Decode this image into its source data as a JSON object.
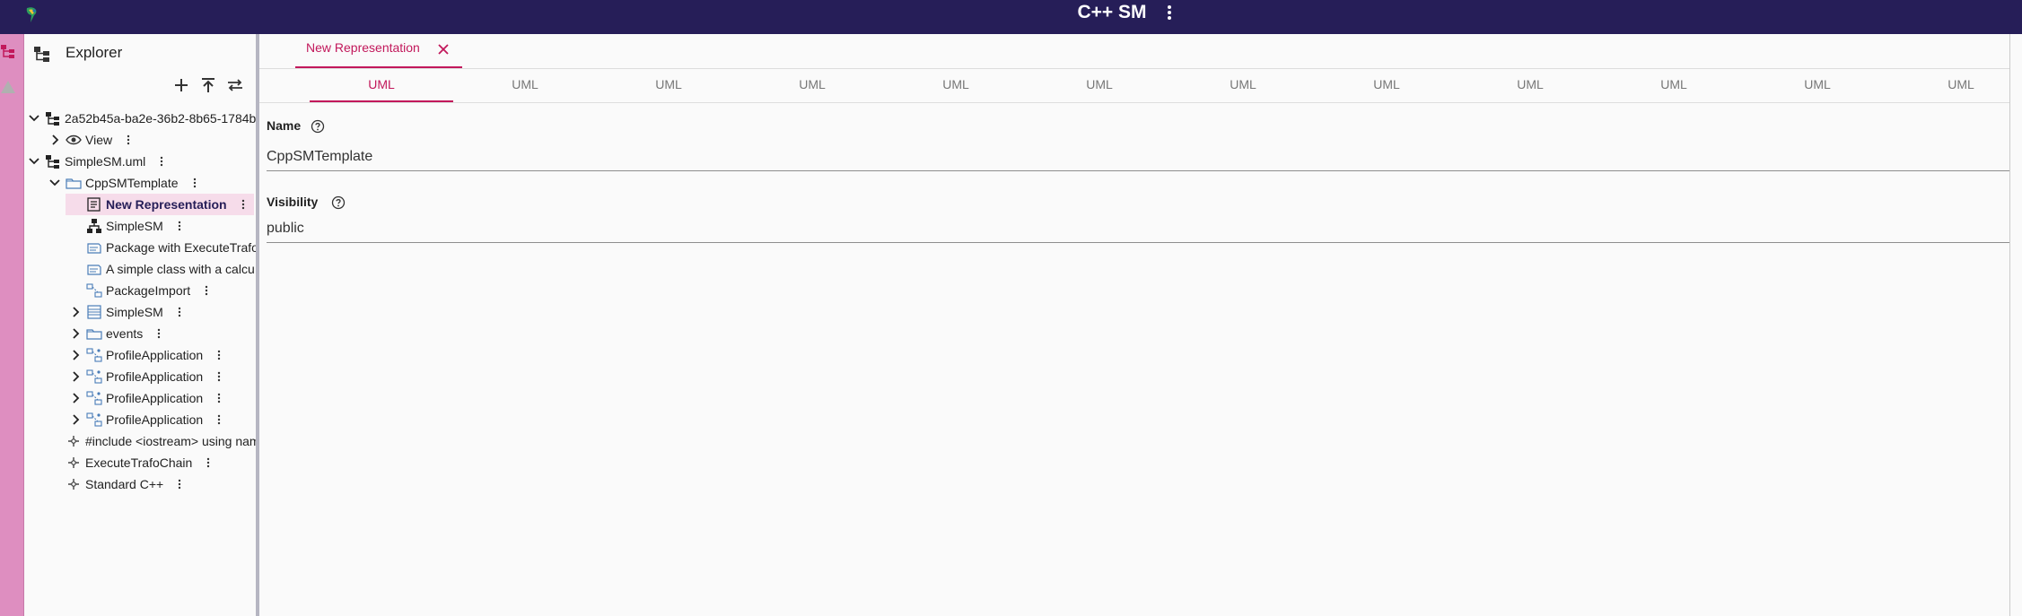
{
  "app": {
    "title": "C++ SM"
  },
  "explorer": {
    "title": "Explorer",
    "tree": [
      {
        "label": "2a52b45a-ba2e-36b2-8b65-1784b",
        "indent": 0,
        "chevron": "down",
        "icon": "model-tree-icon",
        "kebab": false
      },
      {
        "label": "View",
        "indent": 1,
        "chevron": "right",
        "icon": "eye-icon",
        "kebab": true
      },
      {
        "label": "SimpleSM.uml",
        "indent": 0,
        "chevron": "down",
        "icon": "model-tree-icon",
        "kebab": true
      },
      {
        "label": "CppSMTemplate",
        "indent": 1,
        "chevron": "down",
        "icon": "package-folder-icon",
        "kebab": true
      },
      {
        "label": "New Representation",
        "indent": 2,
        "chevron": "none",
        "icon": "representation-doc-icon",
        "kebab": true,
        "selected": true
      },
      {
        "label": "SimpleSM",
        "indent": 2,
        "chevron": "none",
        "icon": "diagram-hierarchy-icon",
        "kebab": true
      },
      {
        "label": "Package with ExecuteTrafo",
        "indent": 2,
        "chevron": "none",
        "icon": "comment-icon",
        "kebab": false
      },
      {
        "label": "A simple class with a calcu",
        "indent": 2,
        "chevron": "none",
        "icon": "comment-icon",
        "kebab": false
      },
      {
        "label": "PackageImport",
        "indent": 2,
        "chevron": "none",
        "icon": "package-import-icon",
        "kebab": true
      },
      {
        "label": "SimpleSM",
        "indent": 2,
        "chevron": "right",
        "icon": "class-icon",
        "kebab": true
      },
      {
        "label": "events",
        "indent": 2,
        "chevron": "right",
        "icon": "package-folder-icon",
        "kebab": true
      },
      {
        "label": "ProfileApplication",
        "indent": 2,
        "chevron": "right",
        "icon": "profile-application-icon",
        "kebab": true
      },
      {
        "label": "ProfileApplication",
        "indent": 2,
        "chevron": "right",
        "icon": "profile-application-icon",
        "kebab": true
      },
      {
        "label": "ProfileApplication",
        "indent": 2,
        "chevron": "right",
        "icon": "profile-application-icon",
        "kebab": true
      },
      {
        "label": "ProfileApplication",
        "indent": 2,
        "chevron": "right",
        "icon": "profile-application-icon",
        "kebab": true
      },
      {
        "label": "#include <iostream> using nam",
        "indent": 1,
        "chevron": "none",
        "icon": "stereotype-icon",
        "kebab": false
      },
      {
        "label": "ExecuteTrafoChain",
        "indent": 1,
        "chevron": "none",
        "icon": "stereotype-icon",
        "kebab": true
      },
      {
        "label": "Standard C++",
        "indent": 1,
        "chevron": "none",
        "icon": "stereotype-icon",
        "kebab": true
      }
    ]
  },
  "editor": {
    "tab_label": "New Representation",
    "subtabs": [
      "UML",
      "UML",
      "UML",
      "UML",
      "UML",
      "UML",
      "UML",
      "UML",
      "UML",
      "UML",
      "UML",
      "UML"
    ],
    "active_subtab": 0,
    "name_label": "Name",
    "name_value": "CppSMTemplate",
    "visibility_label": "Visibility",
    "visibility_value": "public"
  },
  "colors": {
    "topbar": "#261e58",
    "accent": "#c2185b",
    "rail": "#de8ec0",
    "selection": "#f6dcea"
  }
}
